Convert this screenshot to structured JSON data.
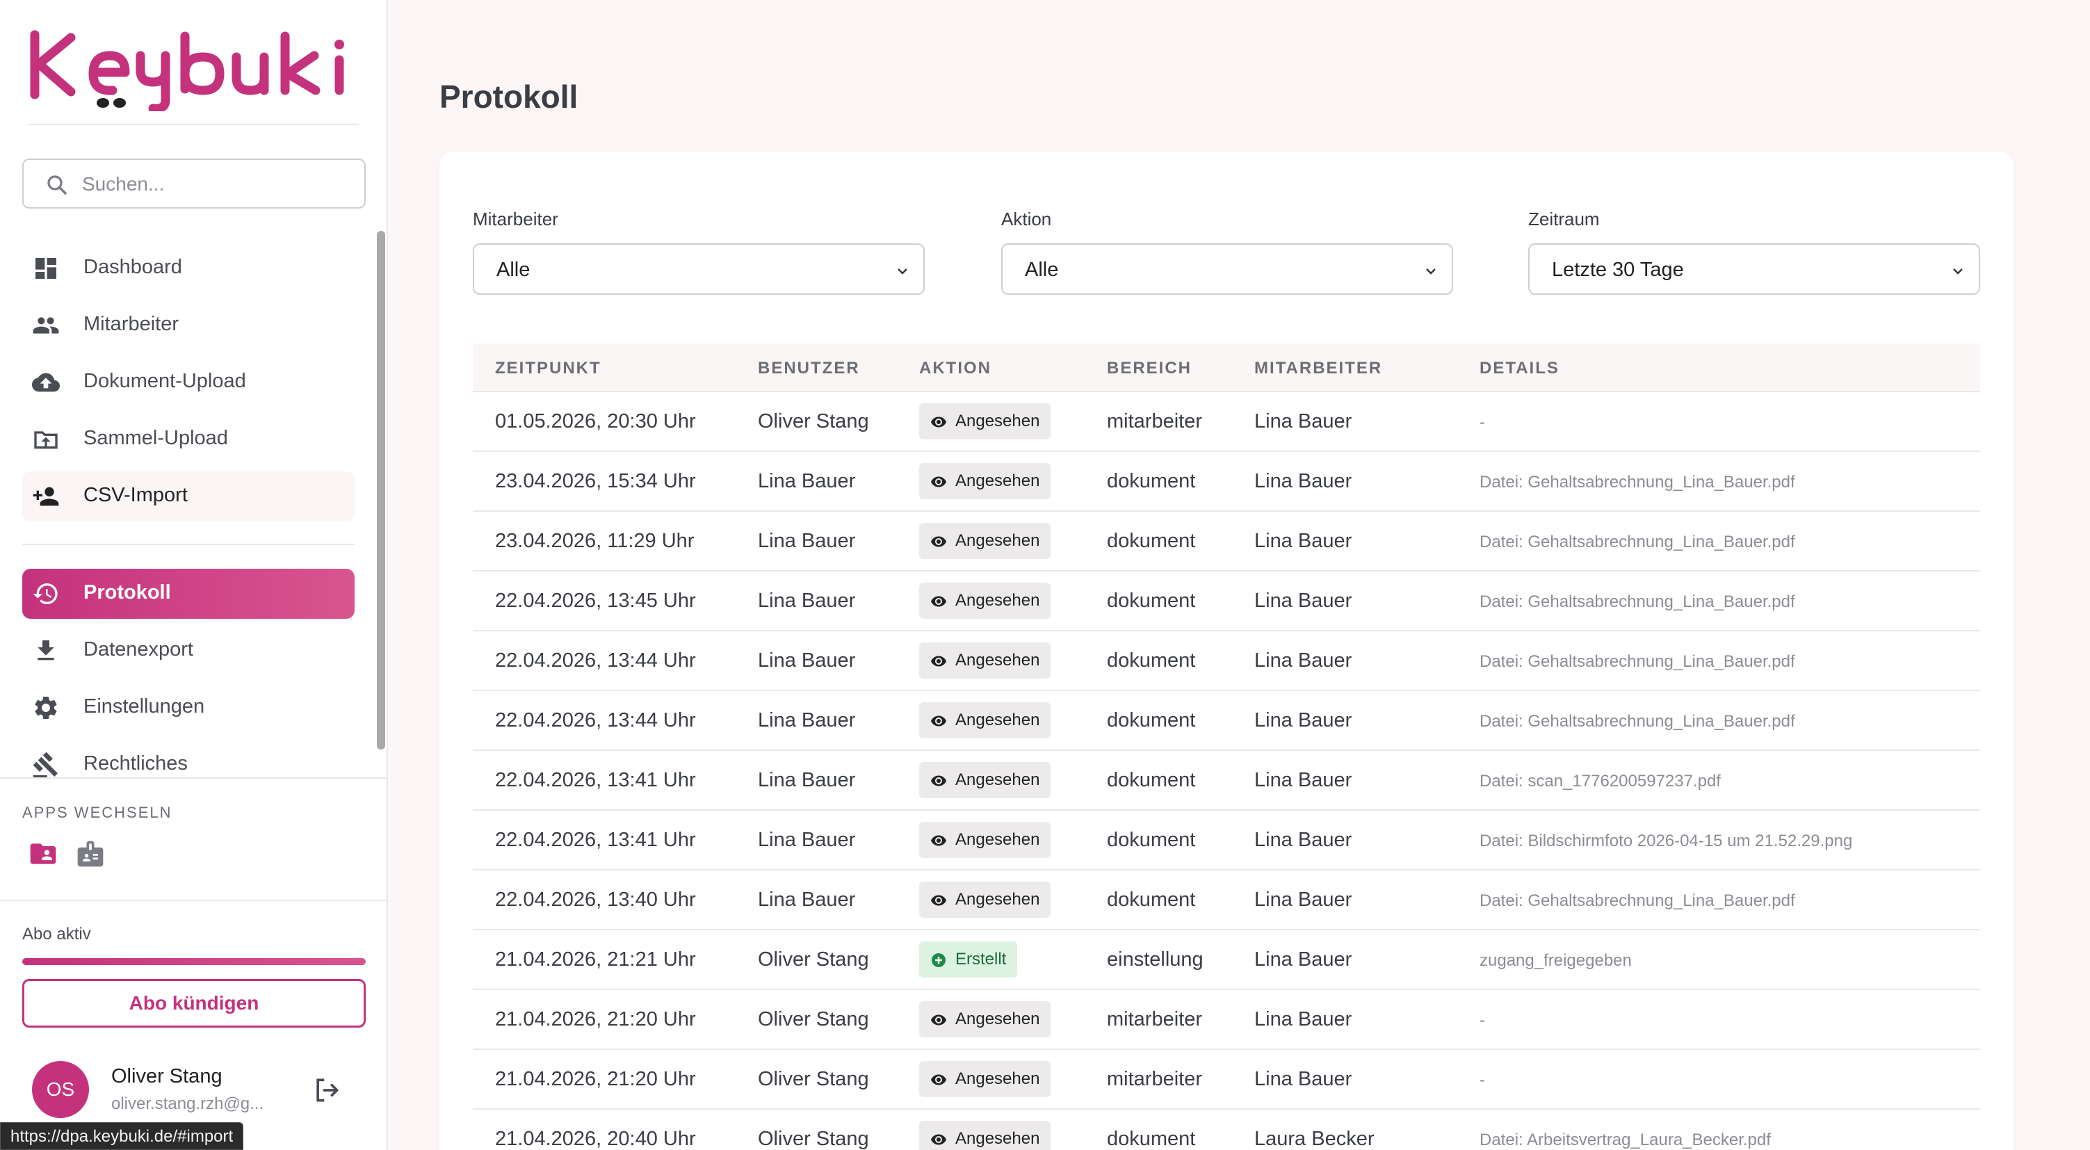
{
  "sidebar": {
    "search_placeholder": "Suchen...",
    "nav": [
      {
        "label": "Dashboard",
        "icon": "dashboard-icon"
      },
      {
        "label": "Mitarbeiter",
        "icon": "people-icon"
      },
      {
        "label": "Dokument-Upload",
        "icon": "cloud-upload-icon"
      },
      {
        "label": "Sammel-Upload",
        "icon": "folder-upload-icon"
      },
      {
        "label": "CSV-Import",
        "icon": "person-add-icon"
      },
      {
        "label": "Protokoll",
        "icon": "history-icon"
      },
      {
        "label": "Datenexport",
        "icon": "download-icon"
      },
      {
        "label": "Einstellungen",
        "icon": "gear-icon"
      },
      {
        "label": "Rechtliches",
        "icon": "gavel-icon"
      }
    ],
    "apps_title": "APPS WECHSELN",
    "abo_label": "Abo aktiv",
    "abo_progress": 1.0,
    "abo_button": "Abo kündigen",
    "user": {
      "initials": "OS",
      "name": "Oliver Stang",
      "email": "oliver.stang.rzh@g..."
    },
    "status_url": "https://dpa.keybuki.de/#import"
  },
  "colors": {
    "accent": "#c4327d",
    "accent_light": "#d9558f"
  },
  "main": {
    "title": "Protokoll",
    "filters": [
      {
        "label": "Mitarbeiter",
        "value": "Alle"
      },
      {
        "label": "Aktion",
        "value": "Alle"
      },
      {
        "label": "Zeitraum",
        "value": "Letzte 30 Tage"
      }
    ],
    "columns": [
      "ZEITPUNKT",
      "BENUTZER",
      "AKTION",
      "BEREICH",
      "MITARBEITER",
      "DETAILS"
    ],
    "rows": [
      {
        "zeitpunkt": "01.05.2026, 20:30 Uhr",
        "benutzer": "Oliver Stang",
        "aktion": "Angesehen",
        "bereich": "mitarbeiter",
        "mitarbeiter": "Lina Bauer",
        "details": "-"
      },
      {
        "zeitpunkt": "23.04.2026, 15:34 Uhr",
        "benutzer": "Lina Bauer",
        "aktion": "Angesehen",
        "bereich": "dokument",
        "mitarbeiter": "Lina Bauer",
        "details": "Datei: Gehaltsabrechnung_Lina_Bauer.pdf"
      },
      {
        "zeitpunkt": "23.04.2026, 11:29 Uhr",
        "benutzer": "Lina Bauer",
        "aktion": "Angesehen",
        "bereich": "dokument",
        "mitarbeiter": "Lina Bauer",
        "details": "Datei: Gehaltsabrechnung_Lina_Bauer.pdf"
      },
      {
        "zeitpunkt": "22.04.2026, 13:45 Uhr",
        "benutzer": "Lina Bauer",
        "aktion": "Angesehen",
        "bereich": "dokument",
        "mitarbeiter": "Lina Bauer",
        "details": "Datei: Gehaltsabrechnung_Lina_Bauer.pdf"
      },
      {
        "zeitpunkt": "22.04.2026, 13:44 Uhr",
        "benutzer": "Lina Bauer",
        "aktion": "Angesehen",
        "bereich": "dokument",
        "mitarbeiter": "Lina Bauer",
        "details": "Datei: Gehaltsabrechnung_Lina_Bauer.pdf"
      },
      {
        "zeitpunkt": "22.04.2026, 13:44 Uhr",
        "benutzer": "Lina Bauer",
        "aktion": "Angesehen",
        "bereich": "dokument",
        "mitarbeiter": "Lina Bauer",
        "details": "Datei: Gehaltsabrechnung_Lina_Bauer.pdf"
      },
      {
        "zeitpunkt": "22.04.2026, 13:41 Uhr",
        "benutzer": "Lina Bauer",
        "aktion": "Angesehen",
        "bereich": "dokument",
        "mitarbeiter": "Lina Bauer",
        "details": "Datei: scan_1776200597237.pdf"
      },
      {
        "zeitpunkt": "22.04.2026, 13:41 Uhr",
        "benutzer": "Lina Bauer",
        "aktion": "Angesehen",
        "bereich": "dokument",
        "mitarbeiter": "Lina Bauer",
        "details": "Datei: Bildschirmfoto 2026-04-15 um 21.52.29.png"
      },
      {
        "zeitpunkt": "22.04.2026, 13:40 Uhr",
        "benutzer": "Lina Bauer",
        "aktion": "Angesehen",
        "bereich": "dokument",
        "mitarbeiter": "Lina Bauer",
        "details": "Datei: Gehaltsabrechnung_Lina_Bauer.pdf"
      },
      {
        "zeitpunkt": "21.04.2026, 21:21 Uhr",
        "benutzer": "Oliver Stang",
        "aktion": "Erstellt",
        "bereich": "einstellung",
        "mitarbeiter": "Lina Bauer",
        "details": "zugang_freigegeben"
      },
      {
        "zeitpunkt": "21.04.2026, 21:20 Uhr",
        "benutzer": "Oliver Stang",
        "aktion": "Angesehen",
        "bereich": "mitarbeiter",
        "mitarbeiter": "Lina Bauer",
        "details": "-"
      },
      {
        "zeitpunkt": "21.04.2026, 21:20 Uhr",
        "benutzer": "Oliver Stang",
        "aktion": "Angesehen",
        "bereich": "mitarbeiter",
        "mitarbeiter": "Lina Bauer",
        "details": "-"
      },
      {
        "zeitpunkt": "21.04.2026, 20:40 Uhr",
        "benutzer": "Oliver Stang",
        "aktion": "Angesehen",
        "bereich": "dokument",
        "mitarbeiter": "Laura Becker",
        "details": "Datei: Arbeitsvertrag_Laura_Becker.pdf"
      }
    ]
  }
}
